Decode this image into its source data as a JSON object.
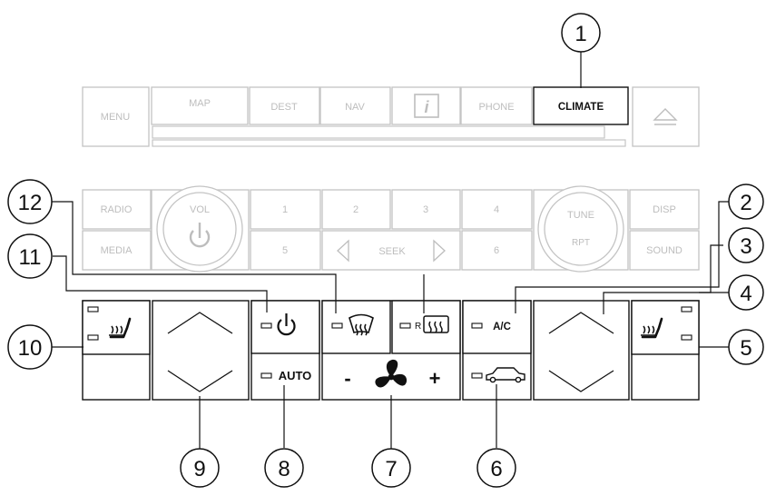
{
  "top_panel": {
    "menu": "MENU",
    "map": "MAP",
    "dest": "DEST",
    "nav": "NAV",
    "info": "i",
    "phone": "PHONE",
    "climate": "CLIMATE"
  },
  "audio_panel": {
    "radio": "RADIO",
    "media": "MEDIA",
    "vol": "VOL",
    "presets": [
      "1",
      "2",
      "3",
      "4",
      "5",
      "6"
    ],
    "seek": "SEEK",
    "tune": "TUNE",
    "rpt": "RPT",
    "disp": "DISP",
    "sound": "SOUND"
  },
  "climate_panel": {
    "auto": "AUTO",
    "ac": "A/C",
    "rear_defrost_prefix": "R",
    "fan_minus": "-",
    "fan_plus": "+"
  },
  "callouts": [
    "1",
    "2",
    "3",
    "4",
    "5",
    "6",
    "7",
    "8",
    "9",
    "10",
    "11",
    "12"
  ]
}
